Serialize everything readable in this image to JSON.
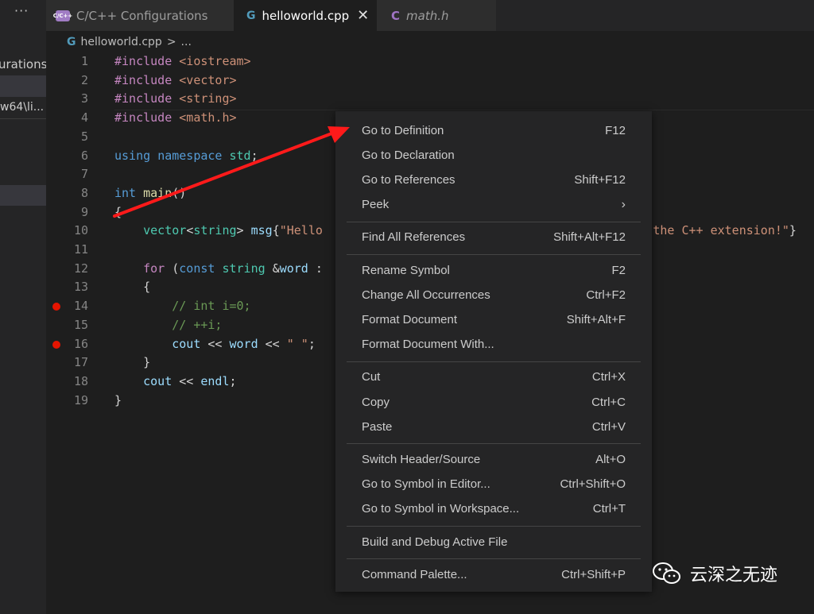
{
  "sidebar": {
    "overflow_icon": "···",
    "title_fragment": "urations",
    "path_fragment": "w64\\li..."
  },
  "tabs": [
    {
      "icon": "C/C++",
      "label": "C/C++ Configurations"
    },
    {
      "icon": "G",
      "label": "helloworld.cpp",
      "close": "✕"
    },
    {
      "icon": "C",
      "label": "math.h"
    }
  ],
  "breadcrumb": {
    "file": "helloworld.cpp",
    "separator": ">",
    "more": "..."
  },
  "code_lines": [
    {
      "n": "1",
      "tokens": [
        [
          "kw",
          "#include "
        ],
        [
          "st",
          "<iostream>"
        ]
      ]
    },
    {
      "n": "2",
      "tokens": [
        [
          "kw",
          "#include "
        ],
        [
          "st",
          "<vector>"
        ]
      ]
    },
    {
      "n": "3",
      "tokens": [
        [
          "kw",
          "#include "
        ],
        [
          "st",
          "<string>"
        ]
      ]
    },
    {
      "n": "4",
      "tokens": [
        [
          "kw",
          "#include "
        ],
        [
          "st",
          "<math.h>"
        ]
      ]
    },
    {
      "n": "5",
      "tokens": []
    },
    {
      "n": "6",
      "tokens": [
        [
          "kb",
          "using "
        ],
        [
          "kb",
          "namespace "
        ],
        [
          "ty",
          "std"
        ],
        [
          "",
          "; "
        ]
      ]
    },
    {
      "n": "7",
      "tokens": []
    },
    {
      "n": "8",
      "tokens": [
        [
          "kb",
          "int "
        ],
        [
          "fn",
          "main"
        ],
        [
          "",
          "()"
        ]
      ]
    },
    {
      "n": "9",
      "tokens": [
        [
          "",
          "{"
        ]
      ]
    },
    {
      "n": "10",
      "tokens": [
        [
          "",
          "    "
        ],
        [
          "ty",
          "vector"
        ],
        [
          "",
          "<"
        ],
        [
          "ty",
          "string"
        ],
        [
          "",
          "> "
        ],
        [
          "va",
          "msg"
        ],
        [
          "",
          "{"
        ],
        [
          "st",
          "\"Hello"
        ],
        [
          "",
          "                                            "
        ],
        [
          "st",
          "d the C++ extension!\""
        ],
        [
          "",
          "}"
        ]
      ]
    },
    {
      "n": "11",
      "tokens": []
    },
    {
      "n": "12",
      "tokens": [
        [
          "",
          "    "
        ],
        [
          "kw",
          "for "
        ],
        [
          "",
          "("
        ],
        [
          "kb",
          "const "
        ],
        [
          "ty",
          "string "
        ],
        [
          "",
          "&"
        ],
        [
          "va",
          "word"
        ],
        [
          "",
          ""
        ],
        [
          "",
          ""
        ],
        [
          "",
          ""
        ],
        [
          "",
          ""
        ],
        [
          "",
          ""
        ],
        [
          "",
          ""
        ],
        [
          "",
          ""
        ],
        [
          "",
          ""
        ],
        [
          "",
          ""
        ],
        [
          "",
          ""
        ],
        [
          "",
          ""
        ],
        [
          "",
          ""
        ],
        [
          "",
          ""
        ],
        [
          "",
          ""
        ],
        [
          "",
          ""
        ],
        [
          "",
          ""
        ],
        [
          "",
          ""
        ],
        [
          "",
          ""
        ],
        [
          "",
          ""
        ],
        [
          "",
          ""
        ],
        [
          "",
          ""
        ],
        [
          "",
          ""
        ],
        [
          "",
          ""
        ],
        [
          "",
          ""
        ],
        [
          "",
          ""
        ],
        [
          "",
          ""
        ],
        [
          "",
          ""
        ],
        [
          "",
          ""
        ],
        [
          "",
          ""
        ],
        [
          "",
          ""
        ],
        [
          "",
          ""
        ],
        [
          "",
          ""
        ],
        [
          "",
          ""
        ],
        [
          "",
          ""
        ],
        [
          "",
          ""
        ],
        [
          "",
          ""
        ],
        [
          "",
          ""
        ],
        [
          "",
          ""
        ],
        [
          "",
          ""
        ],
        [
          "",
          ""
        ],
        [
          "",
          ""
        ],
        [
          "",
          ""
        ],
        [
          "",
          ""
        ],
        [
          "",
          ""
        ],
        [
          "",
          ""
        ],
        [
          "",
          ""
        ],
        [
          "",
          ""
        ],
        [
          "",
          ""
        ],
        [
          "",
          ""
        ],
        [
          "",
          ""
        ],
        [
          "",
          ""
        ],
        [
          "",
          ""
        ],
        [
          "",
          ""
        ],
        [
          "",
          ""
        ],
        [
          "",
          ""
        ],
        [
          "",
          ""
        ],
        [
          "",
          ""
        ],
        [
          "",
          ""
        ],
        [
          "",
          ""
        ],
        [
          "",
          ""
        ],
        [
          "",
          ""
        ],
        [
          "",
          ""
        ],
        [
          "",
          ""
        ],
        [
          "",
          ""
        ],
        [
          "",
          ""
        ],
        [
          "",
          ""
        ],
        [
          "",
          ""
        ],
        [
          "",
          ""
        ],
        [
          "",
          ""
        ],
        [
          "",
          ""
        ],
        [
          "",
          ""
        ],
        [
          "",
          ""
        ],
        [
          "",
          ""
        ],
        [
          "",
          ""
        ],
        [
          "",
          ""
        ],
        [
          "",
          ""
        ],
        [
          "",
          ""
        ],
        [
          "",
          ""
        ],
        [
          "",
          ""
        ],
        [
          "",
          ""
        ],
        [
          "",
          " :"
        ]
      ]
    },
    {
      "n": "13",
      "tokens": [
        [
          "",
          "    {"
        ]
      ]
    },
    {
      "n": "14",
      "bp": true,
      "tokens": [
        [
          "",
          "        "
        ],
        [
          "cm",
          "// int i=0;"
        ]
      ]
    },
    {
      "n": "15",
      "tokens": [
        [
          "",
          "        "
        ],
        [
          "cm",
          "// ++i;"
        ]
      ]
    },
    {
      "n": "16",
      "bp": true,
      "tokens": [
        [
          "",
          "        "
        ],
        [
          "va",
          "cout "
        ],
        [
          "",
          "<< "
        ],
        [
          "va",
          "word "
        ],
        [
          "",
          "<< "
        ],
        [
          "st",
          "\" \""
        ],
        [
          "",
          ";"
        ]
      ]
    },
    {
      "n": "17",
      "tokens": [
        [
          "",
          "    }"
        ]
      ]
    },
    {
      "n": "18",
      "tokens": [
        [
          "",
          "    "
        ],
        [
          "va",
          "cout "
        ],
        [
          "",
          "<< "
        ],
        [
          "va",
          "endl"
        ],
        [
          "",
          ";"
        ]
      ]
    },
    {
      "n": "19",
      "tokens": [
        [
          "",
          "}"
        ]
      ]
    }
  ],
  "context_menu": {
    "groups": [
      [
        {
          "label": "Go to Definition",
          "shortcut": "F12"
        },
        {
          "label": "Go to Declaration",
          "shortcut": ""
        },
        {
          "label": "Go to References",
          "shortcut": "Shift+F12"
        },
        {
          "label": "Peek",
          "shortcut": "",
          "submenu": "›"
        }
      ],
      [
        {
          "label": "Find All References",
          "shortcut": "Shift+Alt+F12"
        }
      ],
      [
        {
          "label": "Rename Symbol",
          "shortcut": "F2"
        },
        {
          "label": "Change All Occurrences",
          "shortcut": "Ctrl+F2"
        },
        {
          "label": "Format Document",
          "shortcut": "Shift+Alt+F"
        },
        {
          "label": "Format Document With...",
          "shortcut": ""
        }
      ],
      [
        {
          "label": "Cut",
          "shortcut": "Ctrl+X"
        },
        {
          "label": "Copy",
          "shortcut": "Ctrl+C"
        },
        {
          "label": "Paste",
          "shortcut": "Ctrl+V"
        }
      ],
      [
        {
          "label": "Switch Header/Source",
          "shortcut": "Alt+O"
        },
        {
          "label": "Go to Symbol in Editor...",
          "shortcut": "Ctrl+Shift+O"
        },
        {
          "label": "Go to Symbol in Workspace...",
          "shortcut": "Ctrl+T"
        }
      ],
      [
        {
          "label": "Build and Debug Active File",
          "shortcut": ""
        }
      ],
      [
        {
          "label": "Command Palette...",
          "shortcut": "Ctrl+Shift+P"
        }
      ]
    ]
  },
  "watermark": {
    "text": "云深之无迹"
  },
  "colors": {
    "breakpoint": "#e51400",
    "annotation_arrow": "#ff1a1a",
    "menu_bg": "#252526"
  }
}
